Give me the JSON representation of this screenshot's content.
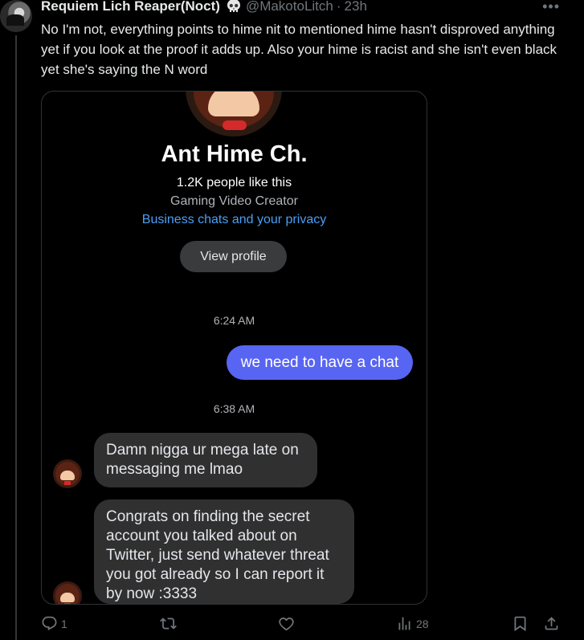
{
  "tweet": {
    "author_name": "Requiem Lich Reaper(Noct)",
    "badge_icon": "skull-emoji",
    "handle": "@MakotoLitch",
    "separator": "·",
    "time": "23h",
    "more_icon": "more-icon",
    "text": "No I'm not, everything points to hime nit to mentioned hime hasn't disproved anything yet if you look at the proof it adds up. Also your hime is racist and she isn't even black yet she's saying the N word"
  },
  "screenshot": {
    "page_name": "Ant Hime Ch.",
    "likes": "1.2K people like this",
    "category": "Gaming Video Creator",
    "privacy_link": "Business chats and your privacy",
    "view_profile": "View profile",
    "timestamp_1": "6:24 AM",
    "sent_message": "we need to have a chat",
    "timestamp_2": "6:38 AM",
    "received_1": "Damn nigga ur mega late on messaging me lmao",
    "received_2": "Congrats on finding the secret account you talked about on Twitter, just send whatever threat you got already so I can report it by now :3333"
  },
  "actions": {
    "reply_icon": "reply-icon",
    "reply_count": "1",
    "retweet_icon": "retweet-icon",
    "like_icon": "heart-icon",
    "views_icon": "views-icon",
    "views_count": "28",
    "bookmark_icon": "bookmark-icon",
    "share_icon": "share-icon"
  }
}
